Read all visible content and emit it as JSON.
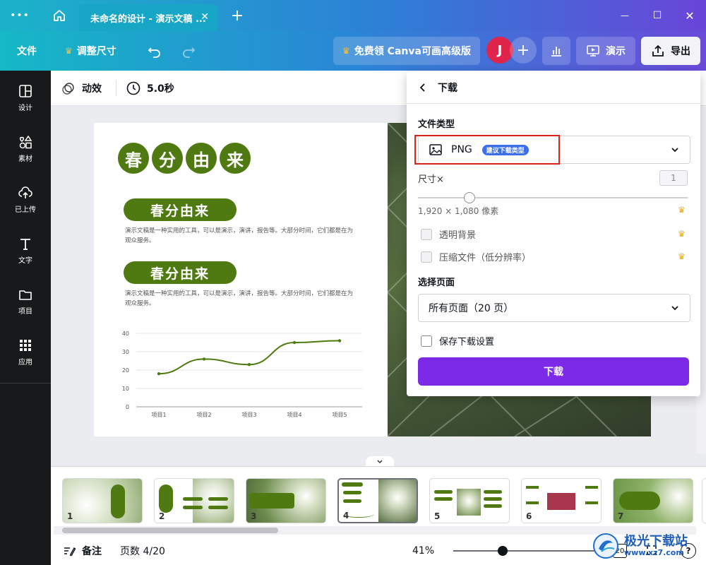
{
  "window": {
    "menu_glyph": "•••",
    "tab_title": "未命名的设计 - 演示文稿 ...",
    "tab_close": "✕",
    "new_tab": "+",
    "minimize": "—",
    "maximize": "☐",
    "close": "✕"
  },
  "toolbar": {
    "file": "文件",
    "resize": "调整尺寸",
    "premium": "免费领 Canva可画高级版",
    "avatar_letter": "J",
    "add": "+",
    "present": "演示",
    "export": "导出"
  },
  "sidebar": {
    "items": [
      {
        "label": "设计",
        "icon": "layout-icon"
      },
      {
        "label": "素材",
        "icon": "elements-icon"
      },
      {
        "label": "已上传",
        "icon": "upload-cloud-icon"
      },
      {
        "label": "文字",
        "icon": "text-icon"
      },
      {
        "label": "项目",
        "icon": "folder-icon"
      },
      {
        "label": "应用",
        "icon": "apps-grid-icon"
      }
    ]
  },
  "editor_bar": {
    "animate": "动效",
    "duration": "5.0秒"
  },
  "slide": {
    "title_chars": [
      "春",
      "分",
      "由",
      "来"
    ],
    "section1_title": "春分由来",
    "section1_text": "演示文稿是一种实用的工具，可以是演示，演讲，报告等。大部分时间，它们都是在为观众服务。",
    "section2_title": "春分由来",
    "section2_text": "演示文稿是一种实用的工具，可以是演示，演讲，报告等。大部分时间，它们都是在为观众服务。"
  },
  "chart_data": {
    "type": "line",
    "categories": [
      "项目1",
      "项目2",
      "项目3",
      "项目4",
      "项目5"
    ],
    "series": [
      {
        "values": [
          18,
          26,
          23,
          35,
          36
        ]
      }
    ],
    "yticks": [
      "0",
      "10",
      "20",
      "30",
      "40"
    ],
    "ylim": [
      0,
      40
    ],
    "grid": true,
    "line_color": "#4f7a12"
  },
  "download_panel": {
    "header": "下载",
    "file_type_label": "文件类型",
    "file_type_value": "PNG",
    "recommended_badge": "建议下载类型",
    "size_label": "尺寸×",
    "size_value": "1",
    "size_ratio": 0.19,
    "dimensions": "1,920 × 1,080 像素",
    "transparent_bg": "透明背景",
    "compress": "压缩文件（低分辨率）",
    "select_pages_label": "选择页面",
    "pages_value": "所有页面（20 页）",
    "save_settings": "保存下载设置",
    "download_button": "下载",
    "accent": "#7d2ae8",
    "crown_color": "#f2a90b"
  },
  "thumbnails": [
    "1",
    "2",
    "3",
    "4",
    "5",
    "6",
    "7"
  ],
  "status": {
    "notes": "备注",
    "page_counter": "页数 4/20",
    "zoom": "41%",
    "zoom_ratio": 0.32,
    "page_count_box": "20"
  },
  "watermark": {
    "name": "极光下载站",
    "url": "www.xz7.com"
  }
}
